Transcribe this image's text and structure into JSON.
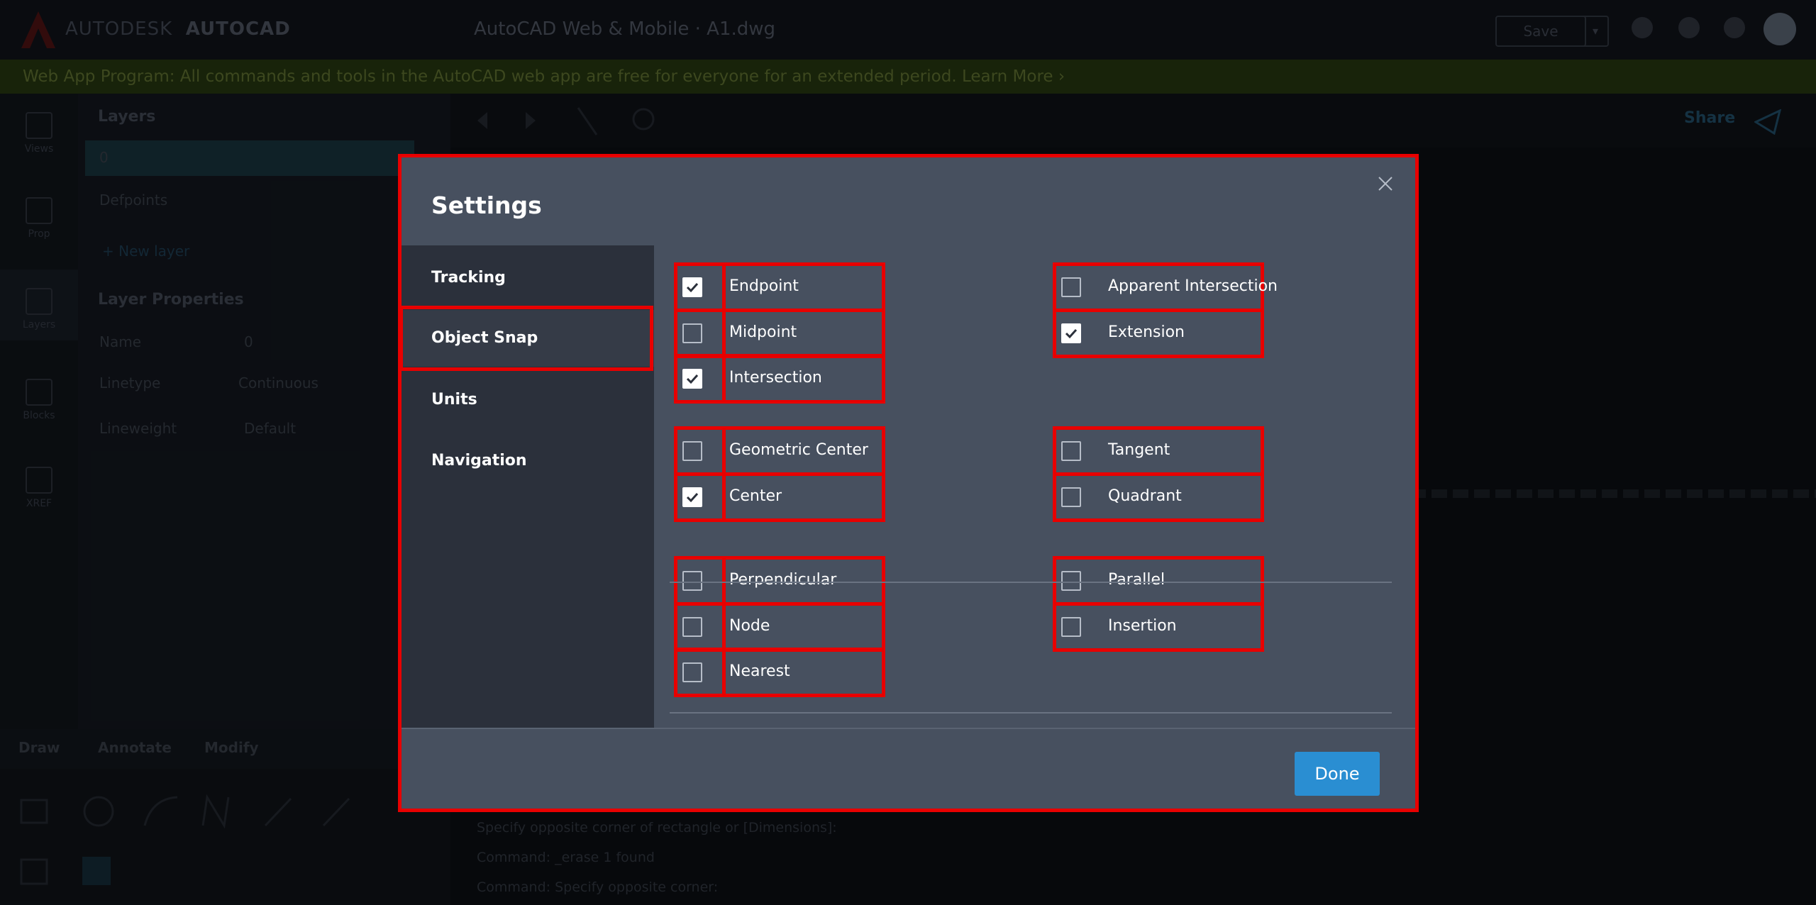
{
  "app": {
    "brand_light": "AUTODESK",
    "brand_bold": "AUTOCAD",
    "doc_title": "AutoCAD Web & Mobile  ·  A1.dwg",
    "save_label": "Save",
    "save_dropdown": "▾"
  },
  "banner": {
    "text": "Web App Program: All commands and tools in the AutoCAD web app are free for everyone for an extended period.  Learn More ›"
  },
  "rail": {
    "items": [
      {
        "label": "Views"
      },
      {
        "label": "Prop"
      },
      {
        "label": "Layers"
      },
      {
        "label": "Blocks"
      },
      {
        "label": "XREF"
      }
    ]
  },
  "panel": {
    "layers_title": "Layers",
    "layer_rows": [
      "0",
      "Defpoints"
    ],
    "new_layer": "+ New layer",
    "props_title": "Layer Properties",
    "props": [
      {
        "key": "Name",
        "value": "0"
      },
      {
        "key": "Linetype",
        "value": "Continuous"
      },
      {
        "key": "Lineweight",
        "value": "Default"
      }
    ]
  },
  "bottom_tabs": [
    "Draw",
    "Annotate",
    "Modify"
  ],
  "canvas": {
    "share_label": "Share",
    "command_lines": [
      "Specify opposite corner of rectangle or [Dimensions]:",
      "Command: _erase 1 found",
      "Command: Specify opposite corner:"
    ]
  },
  "settings": {
    "title": "Settings",
    "tabs": [
      {
        "label": "Tracking",
        "active": false
      },
      {
        "label": "Object Snap",
        "active": true
      },
      {
        "label": "Units",
        "active": false
      },
      {
        "label": "Navigation",
        "active": false
      }
    ],
    "snaps": {
      "g1": {
        "left": [
          {
            "label": "Endpoint",
            "checked": true
          },
          {
            "label": "Midpoint",
            "checked": false
          },
          {
            "label": "Intersection",
            "checked": true
          }
        ],
        "right": [
          {
            "label": "Apparent Intersection",
            "checked": false
          },
          {
            "label": "Extension",
            "checked": true
          }
        ]
      },
      "g2": {
        "left": [
          {
            "label": "Geometric Center",
            "checked": false
          },
          {
            "label": "Center",
            "checked": true
          }
        ],
        "right": [
          {
            "label": "Tangent",
            "checked": false
          },
          {
            "label": "Quadrant",
            "checked": false
          }
        ]
      },
      "g3": {
        "left": [
          {
            "label": "Perpendicular",
            "checked": false
          },
          {
            "label": "Node",
            "checked": false
          },
          {
            "label": "Nearest",
            "checked": false
          }
        ],
        "right": [
          {
            "label": "Parallel",
            "checked": false
          },
          {
            "label": "Insertion",
            "checked": false
          }
        ]
      }
    },
    "done_label": "Done"
  },
  "colors": {
    "highlight": "#e80000",
    "done_button": "#2a8ed2",
    "modal_bg": "#47505f",
    "sidebar_bg": "#2b303b"
  }
}
